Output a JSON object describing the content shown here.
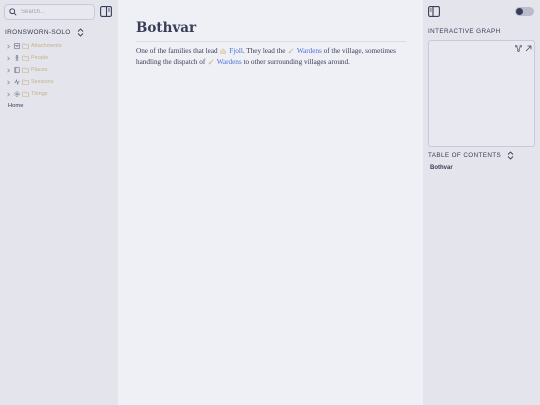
{
  "left_sidebar": {
    "search_placeholder": "Search...",
    "vault_name": "IRONSWORN-SOLO",
    "tree": [
      {
        "label": "Attachments",
        "icon": "archive-icon"
      },
      {
        "label": "People",
        "icon": "person-icon"
      },
      {
        "label": "Places",
        "icon": "book-icon"
      },
      {
        "label": "Sessions",
        "icon": "activity-icon"
      },
      {
        "label": "Things",
        "icon": "gear-icon"
      }
    ],
    "home_label": "Home"
  },
  "note": {
    "title": "Bothvar",
    "text_1": "One of the families that lead",
    "link_1": "Fjoll",
    "text_2": ". They lead the",
    "link_2": "Wardens",
    "text_3": "of the village, sometimes handling the dispatch of",
    "link_3": "Wardens",
    "text_4": "to other surrounding villages around."
  },
  "right_sidebar": {
    "graph_heading": "INTERACTIVE GRAPH",
    "toc_heading": "TABLE OF CONTENTS",
    "toc_items": [
      "Bothvar"
    ]
  },
  "colors": {
    "accent_link": "#4a6fd8",
    "folder_label": "#c9b08a",
    "text": "#3a3d57"
  }
}
